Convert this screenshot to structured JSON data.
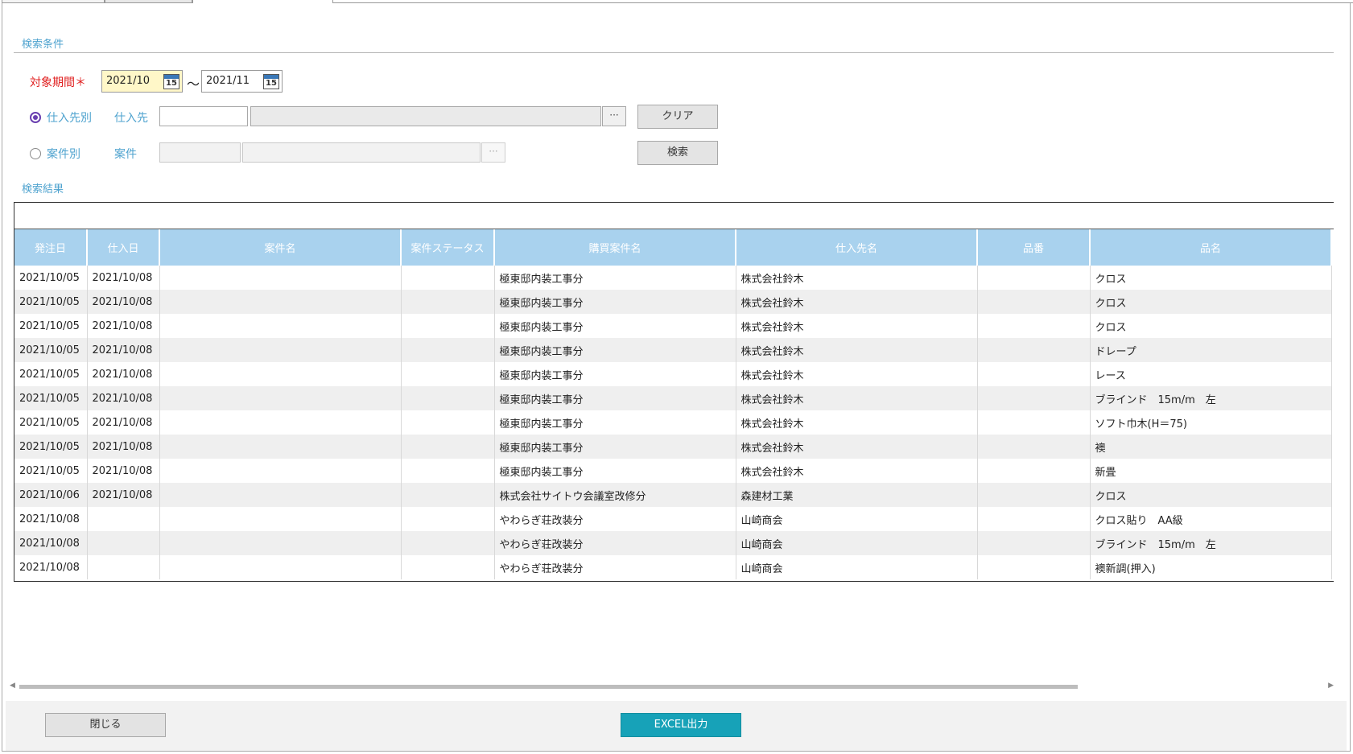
{
  "search_section": {
    "title": "検索条件"
  },
  "period": {
    "label": "対象期間＊",
    "from": "2021/10",
    "to": "2021/11",
    "separator": "～",
    "calendar_glyph": "15"
  },
  "supplier_mode": {
    "radio_label": "仕入先別",
    "field_label": "仕入先",
    "code": "",
    "name": "",
    "selected": true
  },
  "project_mode": {
    "radio_label": "案件別",
    "field_label": "案件",
    "code": "",
    "name": "",
    "selected": false
  },
  "buttons": {
    "browse": "···",
    "clear": "クリア",
    "search": "検索",
    "close": "閉じる",
    "excel": "EXCEL出力"
  },
  "results_section": {
    "title": "検索結果"
  },
  "colors": {
    "accent": "#4fa3cf",
    "header_bg": "#a9d2ee",
    "excel_btn": "#17a2b8",
    "required": "#e02020"
  },
  "table": {
    "columns": [
      "発注日",
      "仕入日",
      "案件名",
      "案件ステータス",
      "購買案件名",
      "仕入先名",
      "品番",
      "品名"
    ],
    "rows": [
      [
        "2021/10/05",
        "2021/10/08",
        "",
        "",
        "極東邸内装工事分",
        "株式会社鈴木",
        "",
        "クロス"
      ],
      [
        "2021/10/05",
        "2021/10/08",
        "",
        "",
        "極東邸内装工事分",
        "株式会社鈴木",
        "",
        "クロス"
      ],
      [
        "2021/10/05",
        "2021/10/08",
        "",
        "",
        "極東邸内装工事分",
        "株式会社鈴木",
        "",
        "クロス"
      ],
      [
        "2021/10/05",
        "2021/10/08",
        "",
        "",
        "極東邸内装工事分",
        "株式会社鈴木",
        "",
        "ドレープ"
      ],
      [
        "2021/10/05",
        "2021/10/08",
        "",
        "",
        "極東邸内装工事分",
        "株式会社鈴木",
        "",
        "レース"
      ],
      [
        "2021/10/05",
        "2021/10/08",
        "",
        "",
        "極東邸内装工事分",
        "株式会社鈴木",
        "",
        "ブラインド　15m/m　左"
      ],
      [
        "2021/10/05",
        "2021/10/08",
        "",
        "",
        "極東邸内装工事分",
        "株式会社鈴木",
        "",
        "ソフト巾木(H＝75)"
      ],
      [
        "2021/10/05",
        "2021/10/08",
        "",
        "",
        "極東邸内装工事分",
        "株式会社鈴木",
        "",
        "襖"
      ],
      [
        "2021/10/05",
        "2021/10/08",
        "",
        "",
        "極東邸内装工事分",
        "株式会社鈴木",
        "",
        "新畳"
      ],
      [
        "2021/10/06",
        "2021/10/08",
        "",
        "",
        "株式会社サイトウ会議室改修分",
        "森建材工業",
        "",
        "クロス"
      ],
      [
        "2021/10/08",
        "",
        "",
        "",
        "やわらぎ荘改装分",
        "山崎商会",
        "",
        "クロス貼り　AA級"
      ],
      [
        "2021/10/08",
        "",
        "",
        "",
        "やわらぎ荘改装分",
        "山崎商会",
        "",
        "ブラインド　15m/m　左"
      ],
      [
        "2021/10/08",
        "",
        "",
        "",
        "やわらぎ荘改装分",
        "山崎商会",
        "",
        "襖新調(押入)"
      ]
    ]
  }
}
